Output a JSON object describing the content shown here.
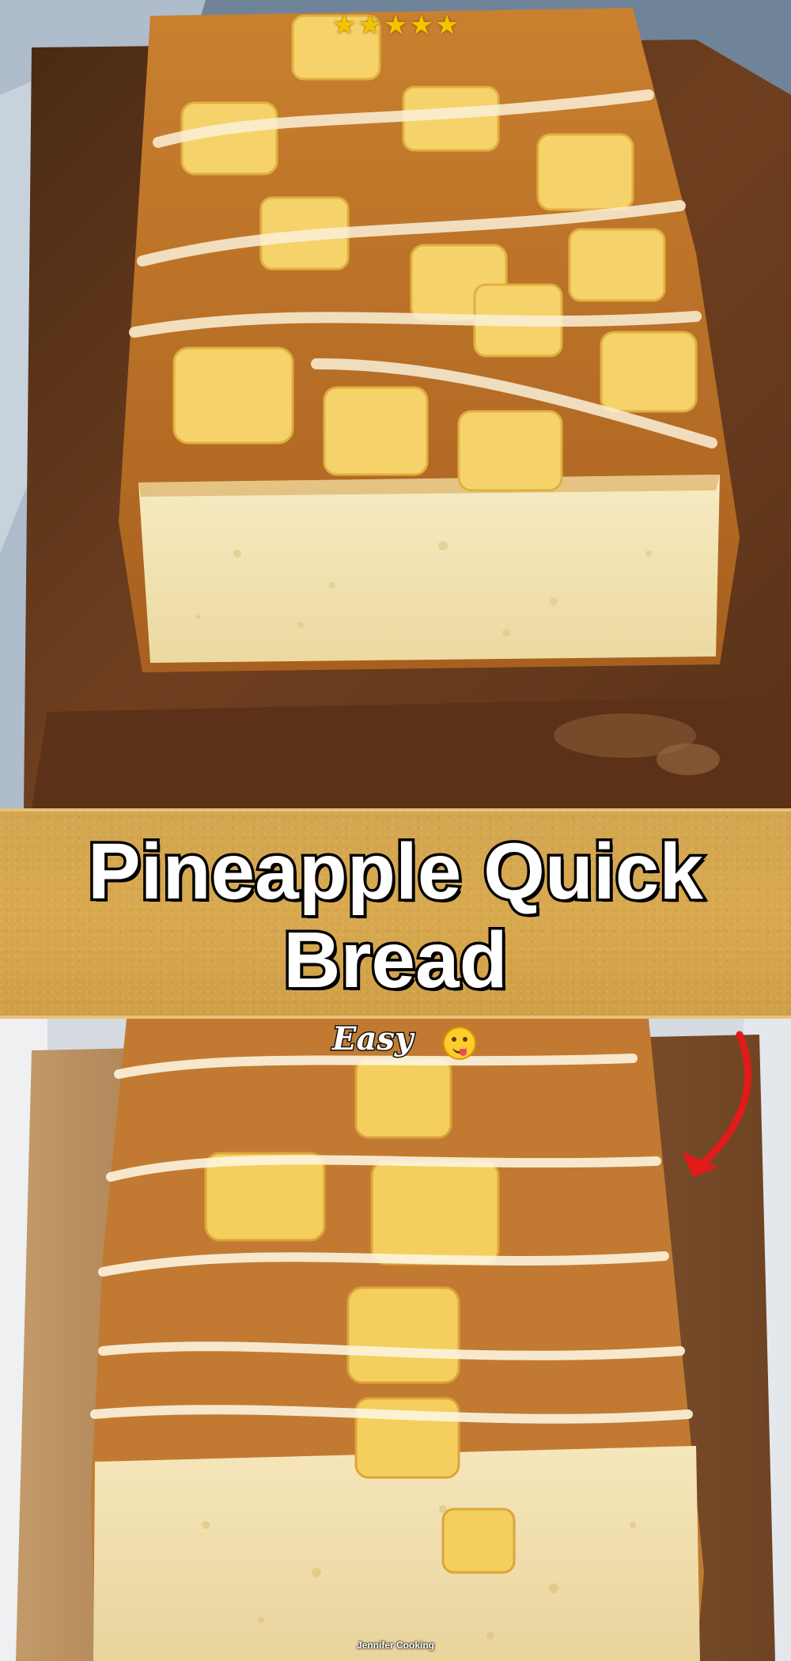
{
  "title": {
    "line1": "Pineapple Quick",
    "line2": "Bread"
  },
  "rating": {
    "stars": 5
  },
  "tag": {
    "label": "Easy",
    "emoji": "face-savoring-food-icon"
  },
  "credit": {
    "text": "Jennifer Cooking"
  },
  "colors": {
    "band": "#d8a94f",
    "title_text": "#ffffff",
    "title_outline": "#000000",
    "star": "#f5c400",
    "arrow": "#e21a1a"
  }
}
